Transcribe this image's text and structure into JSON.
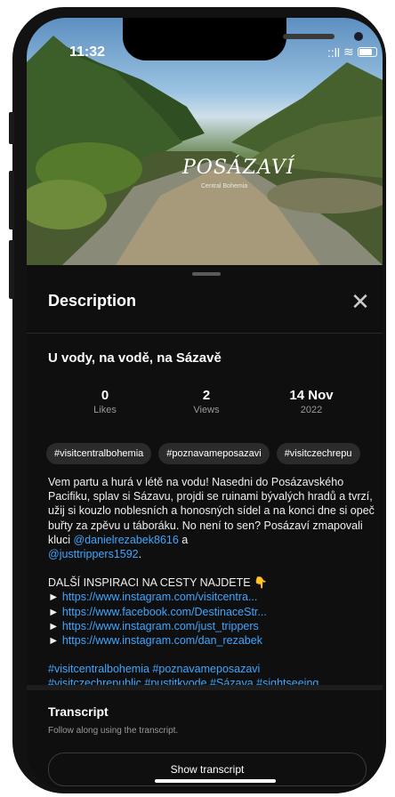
{
  "status": {
    "time": "11:32",
    "signal": "::ll",
    "wifi": "≋"
  },
  "hero": {
    "title": "POSÁZAVÍ",
    "subtitle": "Central Bohemia"
  },
  "panel": {
    "header": "Description",
    "close_symbol": "✕",
    "video_title": "U vody, na vodě, na Sázavě",
    "stats": [
      {
        "num": "0",
        "label": "Likes"
      },
      {
        "num": "2",
        "label": "Views"
      },
      {
        "num": "14 Nov",
        "label": "2022"
      }
    ],
    "tags": [
      "#visitcentralbohemia",
      "#poznavameposazavi",
      "#visitczechrepu"
    ],
    "description": {
      "para1": "Vem partu a hurá v létě na vodu! Nasedni do Posázavského Pacifiku, splav si Sázavu, projdi se ruinami bývalých hradů a tvrzí, užij si kouzlo noblesních a honosných sídel a na konci dne si opeč buřty za zpěvu u táboráku. No není to sen? Posázaví zmapovali kluci ",
      "mention1": "@danielrezabek8616",
      "and": " a ",
      "mention2": "@justtrippers1592",
      "end": ".",
      "inspiration_heading": "DALŠÍ INSPIRACI NA CESTY NAJDETE 👇",
      "links": [
        "https://www.instagram.com/visitcentra...",
        "https://www.facebook.com/DestinaceStr...",
        "https://www.instagram.com/just_trippers",
        "https://www.instagram.com/dan_rezabek"
      ],
      "link_prefix": "►",
      "hashtags_line1": "#visitcentralbohemia #poznavameposazavi",
      "hashtags_line2": "#visitczechrepublic #pustitkvode #Sázava #sightseeing"
    },
    "transcript": {
      "title": "Transcript",
      "subtitle": "Follow along using the transcript.",
      "button": "Show transcript"
    }
  }
}
